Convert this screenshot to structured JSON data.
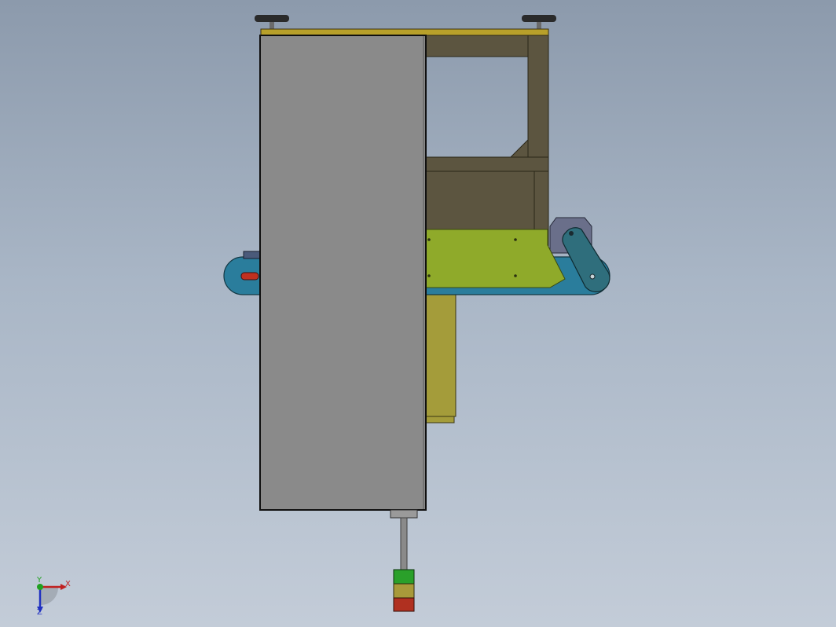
{
  "view": {
    "background_top": "#8c9aac",
    "background_bottom": "#c3ccd8"
  },
  "colors": {
    "cabinet_panel": "#8a8a8a",
    "top_plate": "#b8a02a",
    "frame": "#5c5540",
    "mount_plate": "#8faa2a",
    "conveyor_belt": "#2a7d9c",
    "lower_frame": "#a49c3a",
    "motor": "#6a6f8a",
    "crank_arm": "#2f6e7c",
    "feet": "#2a2a2a",
    "lamp_green": "#2aa02a",
    "lamp_yellow": "#a89a3a",
    "lamp_red": "#b03020"
  },
  "triad": {
    "x_label": "X",
    "y_label": "Y",
    "z_label": "Z",
    "x_color": "#c02020",
    "y_color": "#20a020",
    "z_color": "#2030c0"
  }
}
